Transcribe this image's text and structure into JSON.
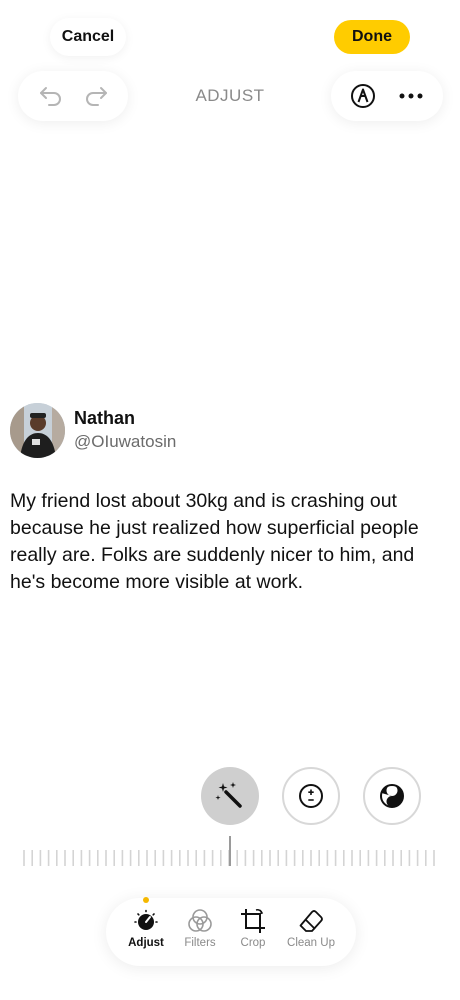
{
  "top_bar": {
    "cancel_label": "Cancel",
    "done_label": "Done",
    "accent_color": "#ffcc00"
  },
  "toolbar": {
    "title": "ADJUST",
    "undo_icon": "undo-arrow-icon",
    "redo_icon": "redo-arrow-icon",
    "markup_icon": "markup-pen-icon",
    "more_icon": "more-ellipsis-icon"
  },
  "tweet": {
    "author_name": "Nathan",
    "author_handle": "@OIuwatosin",
    "text": "My friend lost about 30kg and is crashing out because he just realized how superficial people really are. Folks are suddenly nicer to him, and he's become more visible at work."
  },
  "adjust_tools": [
    {
      "name": "auto-enhance",
      "icon": "magic-wand-icon",
      "selected": true
    },
    {
      "name": "exposure",
      "icon": "exposure-plus-minus-icon",
      "selected": false
    },
    {
      "name": "brilliance",
      "icon": "brilliance-yin-yang-icon",
      "selected": false
    }
  ],
  "bottom_tabs": [
    {
      "label": "Adjust",
      "icon": "adjust-dial-icon",
      "selected": true
    },
    {
      "label": "Filters",
      "icon": "filters-circles-icon",
      "selected": false
    },
    {
      "label": "Crop",
      "icon": "crop-icon",
      "selected": false
    },
    {
      "label": "Clean Up",
      "icon": "eraser-icon",
      "selected": false
    }
  ],
  "indicator_color": "#f5b800"
}
